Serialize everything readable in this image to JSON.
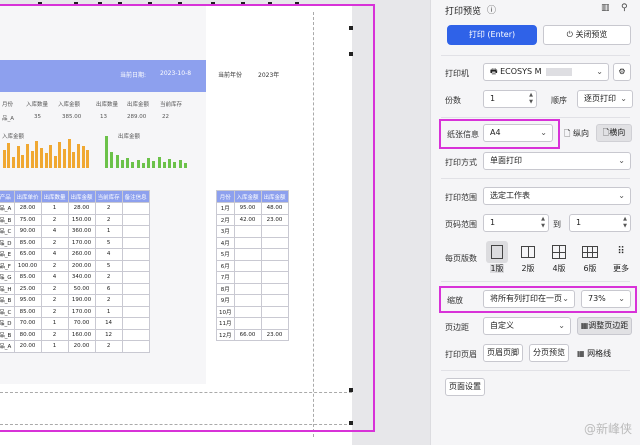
{
  "preview": {
    "date_label": "当前日期:",
    "date_value": "2023-10-8",
    "year_label": "当前年份",
    "year_value": "2023年",
    "summary_headers": [
      "月份",
      "入库数量",
      "入库金额",
      "出库数量",
      "出库金额",
      "当前库存"
    ],
    "summary_row": [
      "品_A",
      "35",
      "385.00",
      "13",
      "289.00",
      "22"
    ],
    "chart_in_title": "入库金额",
    "chart_out_title": "出库金额",
    "table_left_headers": [
      "产品",
      "出库单价",
      "出库数量",
      "出库金额",
      "当前库存",
      "备注信息"
    ],
    "table_left_rows": [
      [
        "品_A",
        "28.00",
        "1",
        "28.00",
        "2",
        ""
      ],
      [
        "品_B",
        "75.00",
        "2",
        "150.00",
        "2",
        ""
      ],
      [
        "品_C",
        "90.00",
        "4",
        "360.00",
        "1",
        ""
      ],
      [
        "品_D",
        "85.00",
        "2",
        "170.00",
        "5",
        ""
      ],
      [
        "品_E",
        "65.00",
        "4",
        "260.00",
        "4",
        ""
      ],
      [
        "品_F",
        "100.00",
        "2",
        "200.00",
        "5",
        ""
      ],
      [
        "品_G",
        "85.00",
        "4",
        "340.00",
        "2",
        ""
      ],
      [
        "品_H",
        "25.00",
        "2",
        "50.00",
        "6",
        ""
      ],
      [
        "品_B",
        "95.00",
        "2",
        "190.00",
        "2",
        ""
      ],
      [
        "品_C",
        "85.00",
        "2",
        "170.00",
        "1",
        ""
      ],
      [
        "品_D",
        "70.00",
        "1",
        "70.00",
        "14",
        ""
      ],
      [
        "品_B",
        "80.00",
        "2",
        "160.00",
        "12",
        ""
      ],
      [
        "品_A",
        "20.00",
        "1",
        "20.00",
        "2",
        ""
      ]
    ],
    "table_right_headers": [
      "月份",
      "入库金额",
      "出库金额"
    ],
    "table_right_rows": [
      [
        "1月",
        "95.00",
        "48.00"
      ],
      [
        "2月",
        "42.00",
        "23.00"
      ],
      [
        "3月",
        "",
        ""
      ],
      [
        "4月",
        "",
        ""
      ],
      [
        "5月",
        "",
        ""
      ],
      [
        "6月",
        "",
        ""
      ],
      [
        "7月",
        "",
        ""
      ],
      [
        "8月",
        "",
        ""
      ],
      [
        "9月",
        "",
        ""
      ],
      [
        "10月",
        "",
        ""
      ],
      [
        "11月",
        "",
        ""
      ],
      [
        "12月",
        "66.00",
        "23.00"
      ]
    ]
  },
  "panel": {
    "title": "打印预览",
    "print_button": "打印 (Enter)",
    "close_button": "关闭预览",
    "printer_label": "打印机",
    "printer_value": "ECOSYS M",
    "copies_label": "份数",
    "copies_value": "1",
    "order_label": "顺序",
    "order_value": "逐页打印",
    "paper_label": "纸张信息",
    "paper_value": "A4",
    "portrait_label": "纵向",
    "landscape_label": "横向",
    "mode_label": "打印方式",
    "mode_value": "单面打印",
    "range_label": "打印范围",
    "range_value": "选定工作表",
    "pages_label": "页码范围",
    "pages_from": "1",
    "pages_to_label": "到",
    "pages_to": "1",
    "per_page_label": "每页版数",
    "layouts": [
      "1版",
      "2版",
      "4版",
      "6版",
      "更多"
    ],
    "scale_label": "缩放",
    "scale_value": "将所有列打印在一页",
    "zoom_value": "73%",
    "margin_label": "页边距",
    "margin_value": "自定义",
    "adjust_margin": "调整页边距",
    "header_label": "打印页眉",
    "header_footer_btn": "页眉页脚",
    "paging_btn": "分页预览",
    "grid_label": "网格线",
    "page_setup_btn": "页面设置",
    "watermark": "@新峰侠"
  },
  "colors": {
    "accent": "#2f62e8",
    "highlight": "#d832d8",
    "header_blue": "#8da0ee",
    "bar_orange": "#f0a832",
    "bar_green": "#6cc24a"
  },
  "charts": {
    "in_values": [
      30,
      42,
      18,
      36,
      22,
      40,
      28,
      45,
      34,
      25,
      38,
      20,
      44,
      32,
      48,
      26,
      40,
      36,
      30
    ],
    "out_values": [
      40,
      20,
      16,
      10,
      12,
      8,
      10,
      6,
      12,
      9,
      14,
      7,
      11,
      8,
      10,
      6
    ]
  }
}
